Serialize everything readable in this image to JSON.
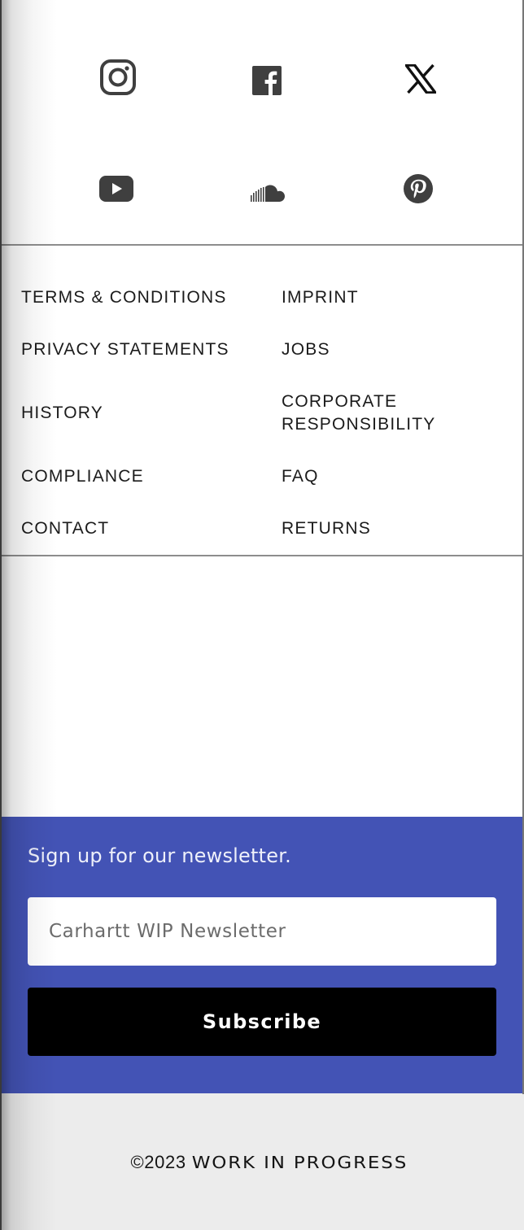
{
  "social": {
    "items": [
      {
        "name": "instagram",
        "icon": "instagram-icon"
      },
      {
        "name": "facebook",
        "icon": "facebook-icon"
      },
      {
        "name": "x",
        "icon": "x-icon"
      },
      {
        "name": "youtube",
        "icon": "youtube-icon"
      },
      {
        "name": "soundcloud",
        "icon": "soundcloud-icon"
      },
      {
        "name": "pinterest",
        "icon": "pinterest-icon"
      }
    ],
    "icon_color": "#3f3f3f"
  },
  "footer_links": {
    "left": [
      "TERMS & CONDITIONS",
      "PRIVACY STATEMENTS",
      "HISTORY",
      "COMPLIANCE",
      "CONTACT"
    ],
    "right": [
      "IMPRINT",
      "JOBS",
      "CORPORATE\nRESPONSIBILITY",
      "FAQ",
      "RETURNS"
    ]
  },
  "newsletter": {
    "title": "Sign up for our newsletter.",
    "input_placeholder": "Carhartt WIP Newsletter",
    "input_value": "",
    "button_label": "Subscribe",
    "background_color": "#4353b5"
  },
  "copyright": {
    "year": "©2023",
    "brand": "WORK IN PROGRESS"
  }
}
